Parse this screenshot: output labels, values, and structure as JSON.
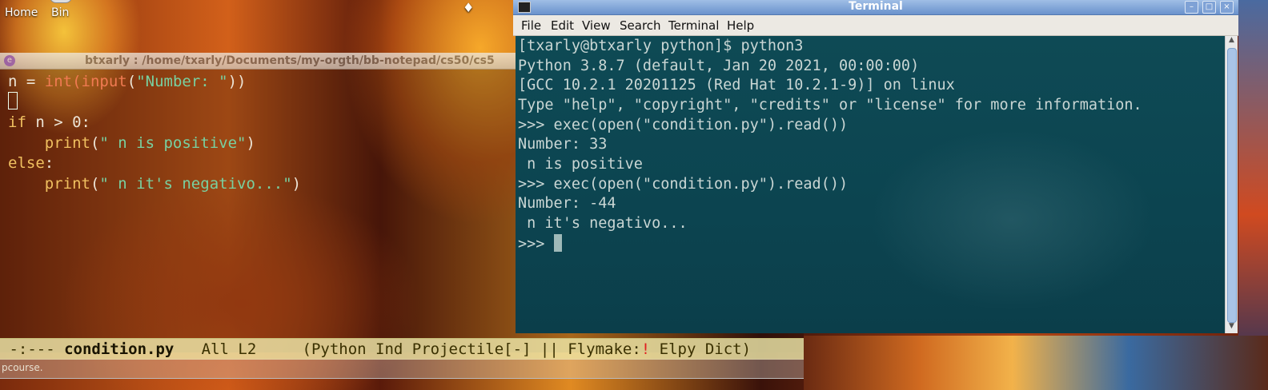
{
  "desktop": {
    "icons": [
      {
        "label": "Home",
        "icon": "home-icon"
      },
      {
        "label": "Bin",
        "icon": "trash-icon"
      }
    ]
  },
  "emacs": {
    "title": "btxarly :  /home/txarly/Documents/my-orgth/bb-notepad/cs50/cs5",
    "code": {
      "l1_var": "n = ",
      "l1_fn1": "int",
      "l1_p1": "(",
      "l1_fn2": "input",
      "l1_p2": "(",
      "l1_str": "\"Number: \"",
      "l1_p3": "))",
      "l3_kw": "if",
      "l3_rest": " n > 0:",
      "l4_indent": "    ",
      "l4_kw": "print",
      "l4_p1": "(",
      "l4_str": "\" n is positive\"",
      "l4_p2": ")",
      "l5_kw": "else",
      "l5_rest": ":",
      "l6_indent": "    ",
      "l6_kw": "print",
      "l6_p1": "(",
      "l6_str": "\" n it's negativo...\"",
      "l6_p2": ")"
    },
    "modeline": {
      "status": " -:--- ",
      "filename": "condition.py",
      "position": "   All L2     ",
      "modes_before": "(Python Ind Projectile[-] || Flymake:",
      "flymake_flag": "!",
      "modes_after": " Elpy Dict)"
    },
    "minibuffer": "pcourse."
  },
  "terminal": {
    "title": "Terminal",
    "menu": [
      "File",
      "Edit",
      "View",
      "Search",
      "Terminal",
      "Help"
    ],
    "lines": [
      "[txarly@btxarly python]$ python3",
      "Python 3.8.7 (default, Jan 20 2021, 00:00:00)",
      "[GCC 10.2.1 20201125 (Red Hat 10.2.1-9)] on linux",
      "Type \"help\", \"copyright\", \"credits\" or \"license\" for more information.",
      ">>> exec(open(\"condition.py\").read())",
      "Number: 33",
      " n is positive",
      ">>> exec(open(\"condition.py\").read())",
      "Number: -44",
      " n it's negativo..."
    ],
    "prompt": ">>> "
  }
}
